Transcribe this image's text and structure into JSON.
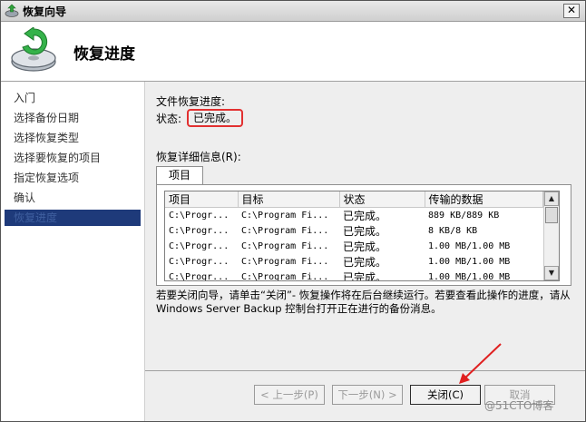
{
  "window": {
    "title": "恢复向导",
    "close_glyph": "✕"
  },
  "header": {
    "title": "恢复进度"
  },
  "nav": {
    "items": [
      {
        "label": "入门"
      },
      {
        "label": "选择备份日期"
      },
      {
        "label": "选择恢复类型"
      },
      {
        "label": "选择要恢复的项目"
      },
      {
        "label": "指定恢复选项"
      },
      {
        "label": "确认"
      },
      {
        "label": "恢复进度"
      }
    ],
    "active_index": 6
  },
  "progress": {
    "label": "文件恢复进度:",
    "status_label": "状态:",
    "status_value": "已完成。"
  },
  "details": {
    "label": "恢复详细信息(R):",
    "tab": "项目",
    "columns": [
      "项目",
      "目标",
      "状态",
      "传输的数据"
    ],
    "rows": [
      {
        "item": "C:\\Progr...",
        "target": "C:\\Program Fi...",
        "status": "已完成。",
        "data": "889 KB/889 KB"
      },
      {
        "item": "C:\\Progr...",
        "target": "C:\\Program Fi...",
        "status": "已完成。",
        "data": "8 KB/8 KB"
      },
      {
        "item": "C:\\Progr...",
        "target": "C:\\Program Fi...",
        "status": "已完成。",
        "data": "1.00 MB/1.00 MB"
      },
      {
        "item": "C:\\Progr...",
        "target": "C:\\Program Fi...",
        "status": "已完成。",
        "data": "1.00 MB/1.00 MB"
      },
      {
        "item": "C:\\Progr...",
        "target": "C:\\Program Fi...",
        "status": "已完成。",
        "data": "1.00 MB/1.00 MB"
      }
    ]
  },
  "note": "若要关闭向导，请单击“关闭”- 恢复操作将在后台继续运行。若要查看此操作的进度，请从 Windows Server Backup 控制台打开正在进行的备份消息。",
  "buttons": {
    "back": "< 上一步(P)",
    "next": "下一步(N) >",
    "close": "关闭(C)",
    "cancel": "取消"
  },
  "watermark": "@51CTO博客",
  "colors": {
    "highlight_red": "#e23030",
    "nav_active_bg": "#1e3a7a"
  }
}
